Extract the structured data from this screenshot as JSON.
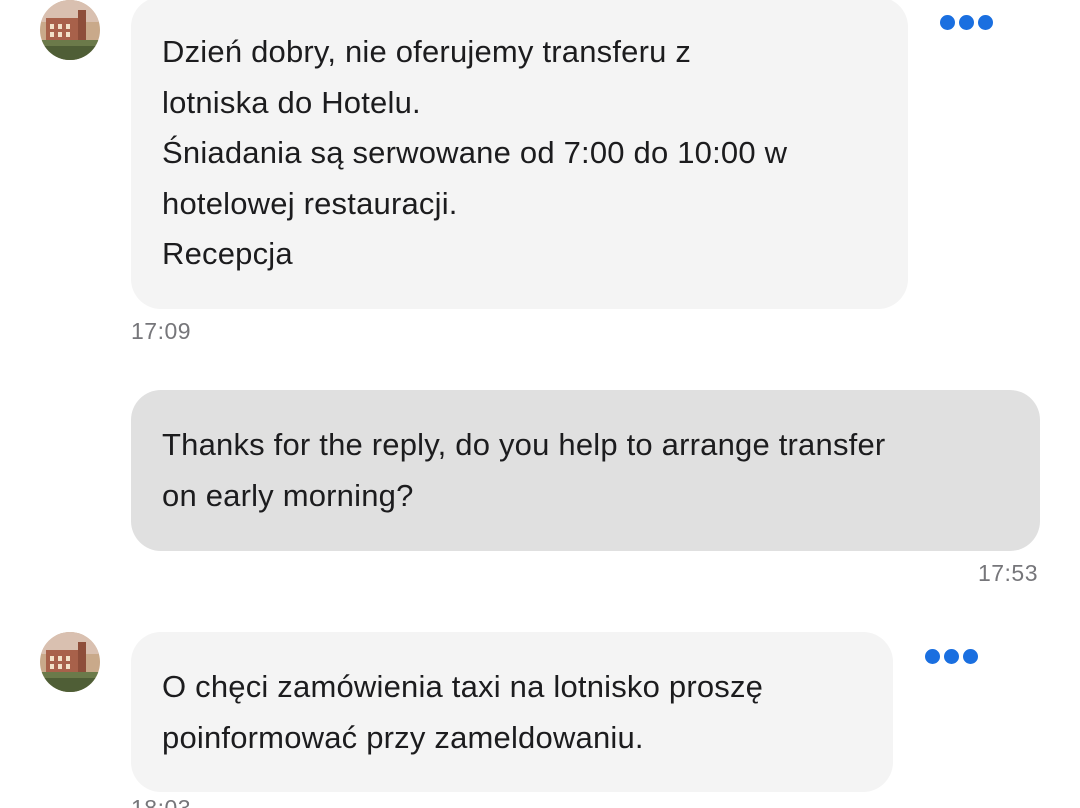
{
  "messages": [
    {
      "direction": "incoming",
      "lines": [
        "Dzień dobry, nie oferujemy transferu z",
        "lotniska do Hotelu.",
        "Śniadania są serwowane od 7:00 do 10:00 w",
        "hotelowej restauracji.",
        "Recepcja"
      ],
      "time": "17:09"
    },
    {
      "direction": "outgoing",
      "lines": [
        "Thanks for the reply, do you help to arrange transfer",
        "on early morning?"
      ],
      "time": "17:53"
    },
    {
      "direction": "incoming",
      "lines": [
        "O chęci zamówienia taxi na lotnisko proszę",
        "poinformować przy zameldowaniu."
      ],
      "time": "18:03"
    }
  ],
  "icons": {
    "avatar": "hotel-avatar-icon",
    "more": "more-options-icon"
  },
  "colors": {
    "incoming_bubble": "#f4f4f4",
    "outgoing_bubble": "#e0e0e0",
    "accent": "#1a6fe0",
    "timestamp": "#76767a"
  }
}
